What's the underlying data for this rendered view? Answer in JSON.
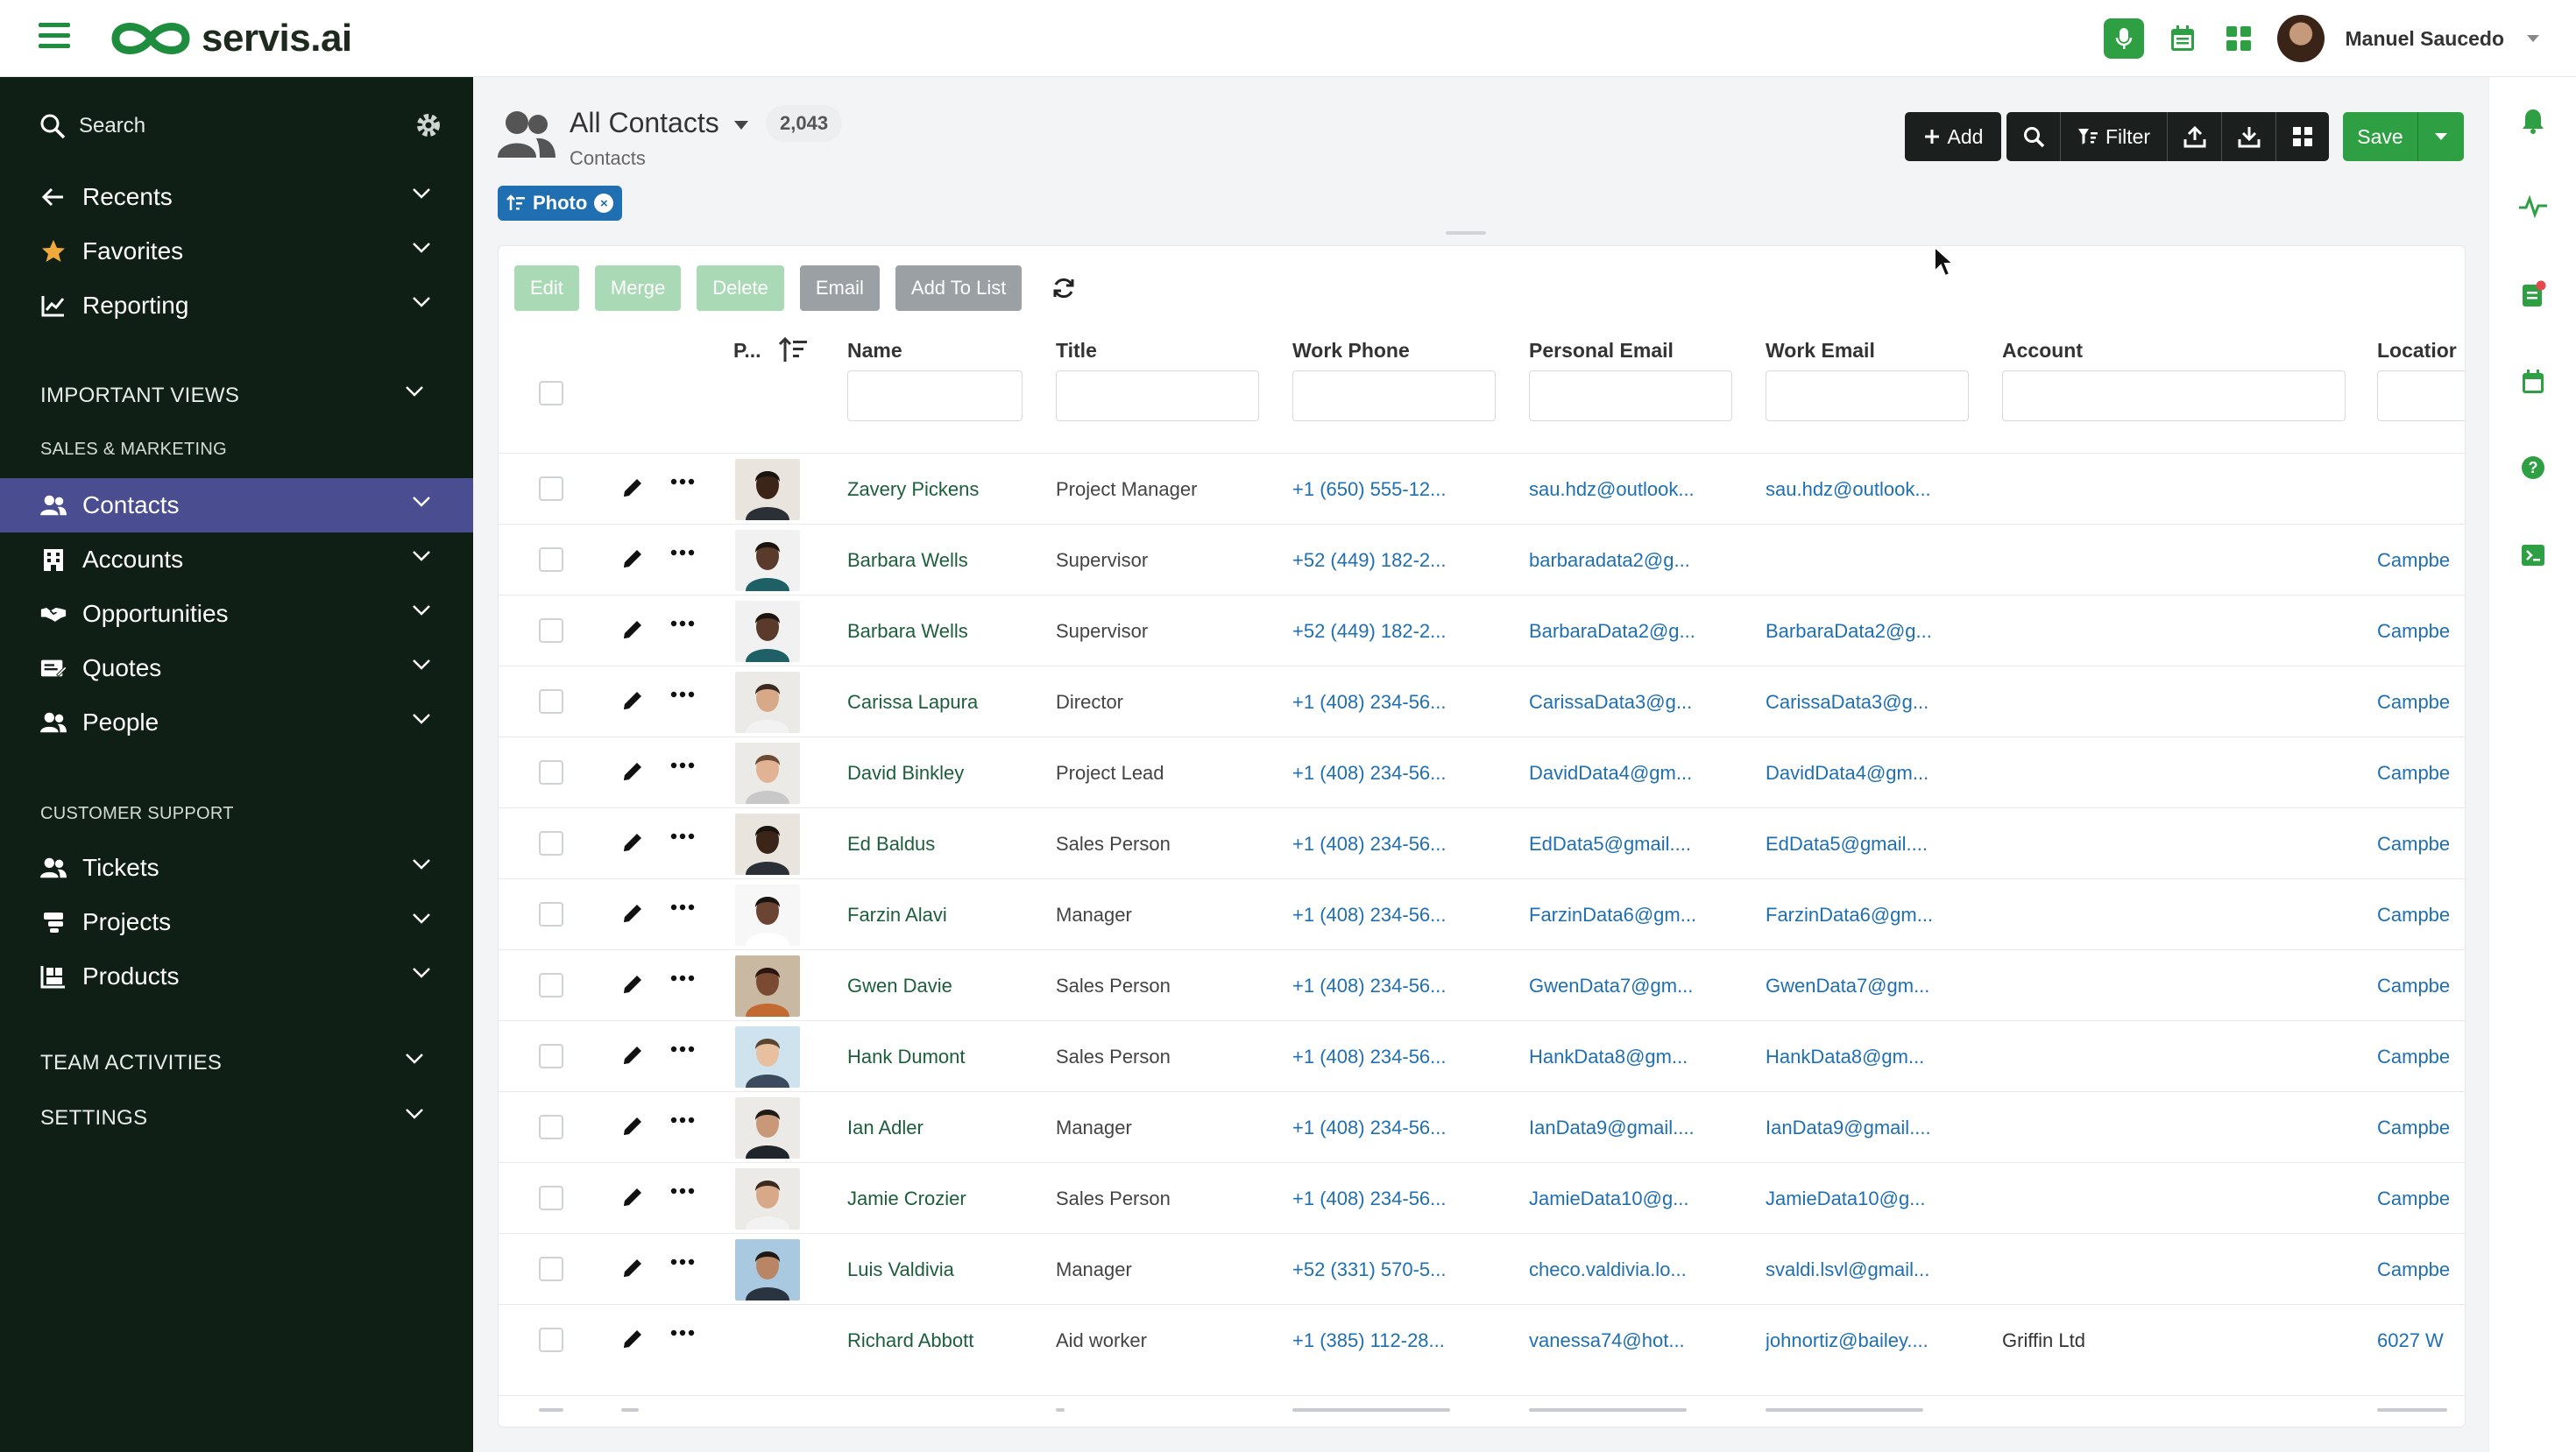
{
  "app": {
    "logo_text": "servis.ai",
    "brand_color": "#2ea043",
    "sidebar_bg": "#0f1f15",
    "active_bg": "#4a4d8f",
    "link_color": "#1f6fb2"
  },
  "topbar": {
    "user_name": "Manuel Saucedo"
  },
  "sidebar": {
    "search_label": "Search",
    "items_top": [
      {
        "label": "Recents",
        "icon": "arrow-left-icon"
      },
      {
        "label": "Favorites",
        "icon": "star-icon"
      },
      {
        "label": "Reporting",
        "icon": "chart-icon"
      }
    ],
    "important_views": "IMPORTANT VIEWS",
    "sales_marketing": "SALES & MARKETING",
    "sales_items": [
      {
        "label": "Contacts",
        "icon": "people-icon",
        "active": true
      },
      {
        "label": "Accounts",
        "icon": "building-icon"
      },
      {
        "label": "Opportunities",
        "icon": "handshake-icon"
      },
      {
        "label": "Quotes",
        "icon": "quote-icon"
      },
      {
        "label": "People",
        "icon": "people-icon"
      }
    ],
    "customer_support": "CUSTOMER SUPPORT",
    "support_items": [
      {
        "label": "Tickets",
        "icon": "people-icon"
      },
      {
        "label": "Projects",
        "icon": "projects-icon"
      },
      {
        "label": "Products",
        "icon": "products-icon"
      }
    ],
    "team_activities": "TEAM ACTIVITIES",
    "settings": "SETTINGS"
  },
  "header": {
    "title": "All Contacts",
    "count": "2,043",
    "subtitle": "Contacts",
    "filter_chip": "Photo"
  },
  "toolbar": {
    "add_label": "Add",
    "filter_label": "Filter",
    "save_label": "Save"
  },
  "actions": {
    "edit": "Edit",
    "merge": "Merge",
    "delete": "Delete",
    "email": "Email",
    "add_to_list": "Add To List"
  },
  "table": {
    "columns": {
      "photo": "P...",
      "name": "Name",
      "title": "Title",
      "work_phone": "Work Phone",
      "personal_email": "Personal Email",
      "work_email": "Work Email",
      "account": "Account",
      "location": "Locatior"
    },
    "rows": [
      {
        "name": "Zavery Pickens",
        "title": "Project Manager",
        "phone": "+1 (650) 555-12...",
        "personal_email": "sau.hdz@outlook...",
        "work_email": "sau.hdz@outlook...",
        "account": "",
        "location": "",
        "photo": "dark"
      },
      {
        "name": "Barbara Wells",
        "title": "Supervisor",
        "phone": "+52 (449) 182-2...",
        "personal_email": "barbaradata2@g...",
        "work_email": "",
        "account": "",
        "location": "Campbe",
        "photo": "teal"
      },
      {
        "name": "Barbara Wells",
        "title": "Supervisor",
        "phone": "+52 (449) 182-2...",
        "personal_email": "BarbaraData2@g...",
        "work_email": "BarbaraData2@g...",
        "account": "",
        "location": "Campbe",
        "photo": "teal"
      },
      {
        "name": "Carissa Lapura",
        "title": "Director",
        "phone": "+1 (408) 234-56...",
        "personal_email": "CarissaData3@g...",
        "work_email": "CarissaData3@g...",
        "account": "",
        "location": "Campbe",
        "photo": "light"
      },
      {
        "name": "David Binkley",
        "title": "Project Lead",
        "phone": "+1 (408) 234-56...",
        "personal_email": "DavidData4@gm...",
        "work_email": "DavidData4@gm...",
        "account": "",
        "location": "Campbe",
        "photo": "beard"
      },
      {
        "name": "Ed Baldus",
        "title": "Sales Person",
        "phone": "+1 (408) 234-56...",
        "personal_email": "EdData5@gmail....",
        "work_email": "EdData5@gmail....",
        "account": "",
        "location": "Campbe",
        "photo": "dark"
      },
      {
        "name": "Farzin Alavi",
        "title": "Manager",
        "phone": "+1 (408) 234-56...",
        "personal_email": "FarzinData6@gm...",
        "work_email": "FarzinData6@gm...",
        "account": "",
        "location": "Campbe",
        "photo": "white"
      },
      {
        "name": "Gwen Davie",
        "title": "Sales Person",
        "phone": "+1 (408) 234-56...",
        "personal_email": "GwenData7@gm...",
        "work_email": "GwenData7@gm...",
        "account": "",
        "location": "Campbe",
        "photo": "curly"
      },
      {
        "name": "Hank Dumont",
        "title": "Sales Person",
        "phone": "+1 (408) 234-56...",
        "personal_email": "HankData8@gm...",
        "work_email": "HankData8@gm...",
        "account": "",
        "location": "Campbe",
        "photo": "glasses"
      },
      {
        "name": "Ian Adler",
        "title": "Manager",
        "phone": "+1 (408) 234-56...",
        "personal_email": "IanData9@gmail....",
        "work_email": "IanData9@gmail....",
        "account": "",
        "location": "Campbe",
        "photo": "suit"
      },
      {
        "name": "Jamie Crozier",
        "title": "Sales Person",
        "phone": "+1 (408) 234-56...",
        "personal_email": "JamieData10@g...",
        "work_email": "JamieData10@g...",
        "account": "",
        "location": "Campbe",
        "photo": "light"
      },
      {
        "name": "Luis Valdivia",
        "title": "Manager",
        "phone": "+52 (331) 570-5...",
        "personal_email": "checo.valdivia.lo...",
        "work_email": "svaldi.lsvl@gmail...",
        "account": "",
        "location": "Campbe",
        "photo": "blue"
      },
      {
        "name": "Richard Abbott",
        "title": "Aid worker",
        "phone": "+1 (385) 112-28...",
        "personal_email": "vanessa74@hot...",
        "work_email": "johnortiz@bailey....",
        "account": "Griffin Ltd",
        "location": "6027 W",
        "photo": "none"
      }
    ]
  }
}
